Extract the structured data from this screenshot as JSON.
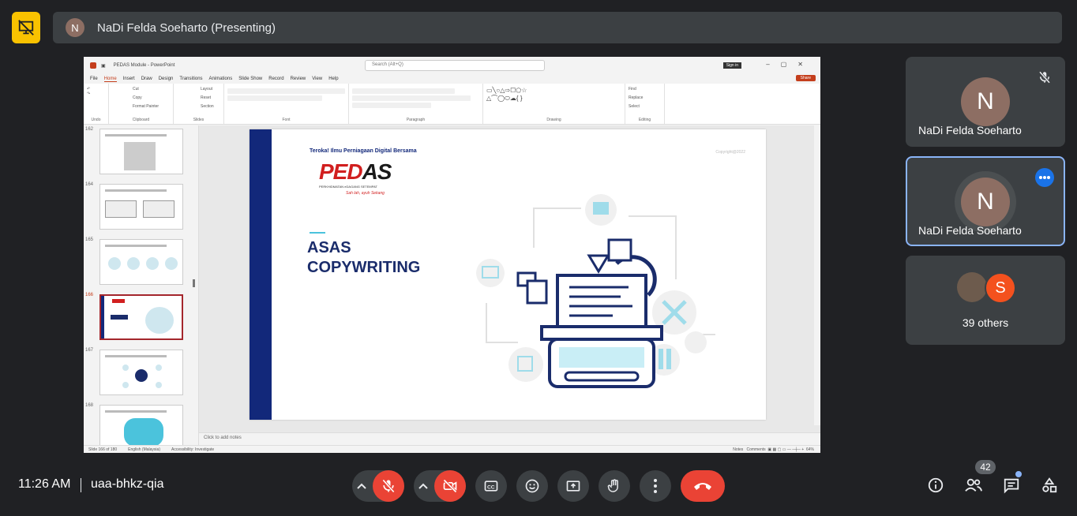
{
  "header": {
    "presenter_initial": "N",
    "presenting_title": "NaDi Felda Soeharto (Presenting)"
  },
  "powerpoint": {
    "window_title": "PEDAS Module - PowerPoint",
    "search_placeholder": "Search (Alt+Q)",
    "sign_in": "Sign in",
    "share": "Share",
    "tabs": [
      "File",
      "Home",
      "Insert",
      "Draw",
      "Design",
      "Transitions",
      "Animations",
      "Slide Show",
      "Record",
      "Review",
      "View",
      "Help"
    ],
    "ribbon_groups": [
      "Undo",
      "Clipboard",
      "Slides",
      "Font",
      "Paragraph",
      "Drawing",
      "Editing"
    ],
    "clipboard_items": [
      "Cut",
      "Copy",
      "Format Painter"
    ],
    "slides_items": [
      "Layout",
      "Reset",
      "Section"
    ],
    "editing_items": [
      "Find",
      "Replace",
      "Select"
    ],
    "thumbnails": [
      {
        "num": "162",
        "selected": false
      },
      {
        "num": "164",
        "selected": false
      },
      {
        "num": "165",
        "selected": false
      },
      {
        "num": "166",
        "selected": true
      },
      {
        "num": "167",
        "selected": false
      },
      {
        "num": "168",
        "selected": false
      }
    ],
    "slide": {
      "subtitle": "Teroka! Ilmu Perniagaan Digital Bersama",
      "logo_red": "PED",
      "logo_dark": "AS",
      "logo_tagline": "PERKHIDMATAN eDAGANG SETEMPAT",
      "logo_slogan": "Sah lah, ayuh Sekang",
      "copyright": "Copyright@2022",
      "title_line1": "ASAS",
      "title_line2": "COPYWRITING"
    },
    "notes_placeholder": "Click to add notes",
    "status": {
      "slide_count": "Slide 166 of 180",
      "language": "English (Malaysia)",
      "accessibility": "Accessibility: Investigate",
      "notes": "Notes",
      "comments": "Comments",
      "zoom": "64%"
    }
  },
  "participants": {
    "tile1_initial": "N",
    "tile1_name": "NaDi Felda Soeharto",
    "tile2_initial": "N",
    "tile2_name": "NaDi Felda Soeharto",
    "others_initial": "S",
    "others_label": "39 others"
  },
  "bottom": {
    "time": "11:26 AM",
    "meeting_code": "uaa-bhkz-qia",
    "people_count": "42"
  },
  "colors": {
    "background": "#202124",
    "tile": "#3c4043",
    "danger": "#ea4335",
    "presenting_yellow": "#f9c200",
    "accent_blue": "#8ab4f8"
  }
}
